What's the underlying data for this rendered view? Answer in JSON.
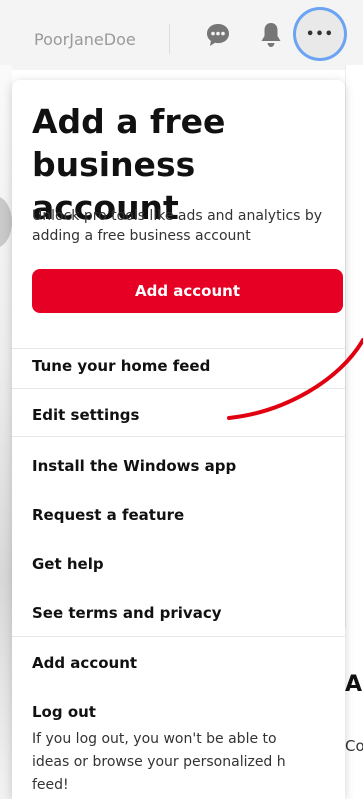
{
  "header": {
    "username": "PoorJaneDoe",
    "icons": [
      "chat-bubble-icon",
      "bell-icon",
      "more-dots-icon"
    ],
    "more_glyph": "•••"
  },
  "menu": {
    "promo": {
      "title": "Add a free business account",
      "description": "Unlock pro tools like ads and analytics by adding a free business account",
      "button_label": "Add account"
    },
    "items": [
      "Tune your home feed",
      "Edit settings",
      "Install the Windows app",
      "Request a feature",
      "Get help",
      "See terms and privacy",
      "Add account",
      "Log out"
    ],
    "logout_note": "If you log out, you won't be able to ideas or browse your personalized h feed!"
  },
  "background": {
    "heading_fragment": "A",
    "text_fragment": "Co Pi"
  },
  "colors": {
    "accent": "#e60023",
    "annotation": "#e00010",
    "focus_ring": "#6aa4f2"
  }
}
